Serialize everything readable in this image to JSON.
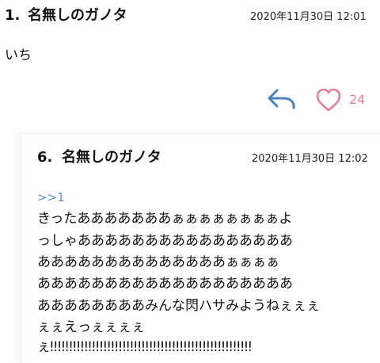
{
  "post1": {
    "number": "1.",
    "author": "名無しのガノタ",
    "date": "2020年11月30日 12:01",
    "body": "いち"
  },
  "actions": {
    "like_count": "24",
    "reply_icon": "reply-arrow-icon",
    "like_icon": "heart-icon",
    "reply_color": "#4b82be",
    "like_color": "#e87f96"
  },
  "post6": {
    "number": "6.",
    "author": "名無しのガノタ",
    "date": "2020年11月30日 12:02",
    "anchor": ">>1",
    "body_lines": [
      "きったあああああああぁぁぁぁぁぁぁぁよ",
      "っしゃああああああああああああああああ",
      "ああああああああああああああぁぁぁぁ",
      "あああああああああああああああああああ",
      "ああああああああみんな閃ハサみようねぇぇぇ",
      "ぇぇえっぇぇぇぇ",
      "ぇ!!!!!!!!!!!!!!!!!!!!!!!!!!!!!!!!!!!!!!!!!!!!!!!!!!!!!"
    ]
  }
}
